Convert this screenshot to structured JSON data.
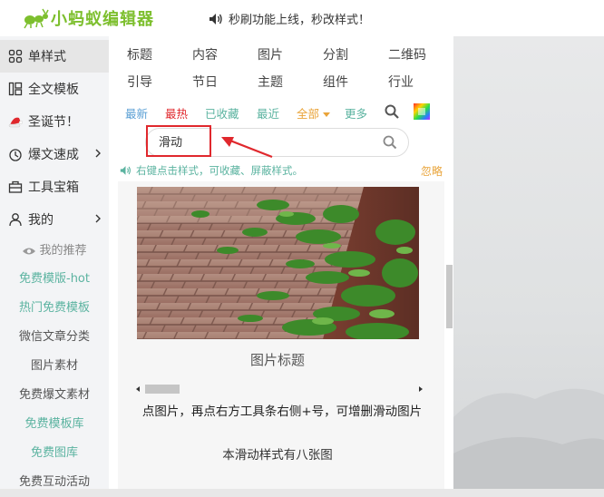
{
  "topbar": {
    "logo_text": "小蚂蚁编辑器",
    "notice": "秒刷功能上线，秒改样式！"
  },
  "sidebar": {
    "items": [
      {
        "label": "单样式",
        "icon": "grid-icon"
      },
      {
        "label": "全文模板",
        "icon": "template-icon"
      },
      {
        "label": "圣诞节！",
        "icon": "santa-hat-icon"
      },
      {
        "label": "爆文速成",
        "icon": "fire-icon"
      },
      {
        "label": "工具宝箱",
        "icon": "toolbox-icon"
      },
      {
        "label": "我的",
        "icon": "user-icon"
      }
    ],
    "subitems": [
      {
        "label": "我的推荐",
        "icon": "eye-icon"
      },
      {
        "label": "免费模版-hot"
      },
      {
        "label": "热门免费模板"
      },
      {
        "label": "微信文章分类"
      },
      {
        "label": "图片素材"
      },
      {
        "label": "免费爆文素材"
      },
      {
        "label": "免费模板库"
      },
      {
        "label": "免费图库"
      },
      {
        "label": "免费互动活动"
      }
    ]
  },
  "categories": {
    "row1": [
      "标题",
      "内容",
      "图片",
      "分割",
      "二维码"
    ],
    "row2": [
      "引导",
      "节日",
      "主题",
      "组件",
      "行业"
    ]
  },
  "filters": {
    "latest": "最新",
    "hottest": "最热",
    "favorited": "已收藏",
    "recent": "最近",
    "all": "全部",
    "more": "更多"
  },
  "search": {
    "value": "滑动"
  },
  "tip": {
    "text": "右键点击样式，可收藏、屏蔽样式。",
    "ignore": "忽略"
  },
  "preview": {
    "caption": "图片标题",
    "description": "点图片，再点右方工具条右侧+号，可增删滑动图片",
    "description2": "本滑动样式有八张图"
  },
  "colors": {
    "brand_green": "#7dbf2e",
    "tip_teal": "#5bb3a0",
    "accent_red": "#e0282d",
    "accent_orange": "#e9a43a"
  }
}
